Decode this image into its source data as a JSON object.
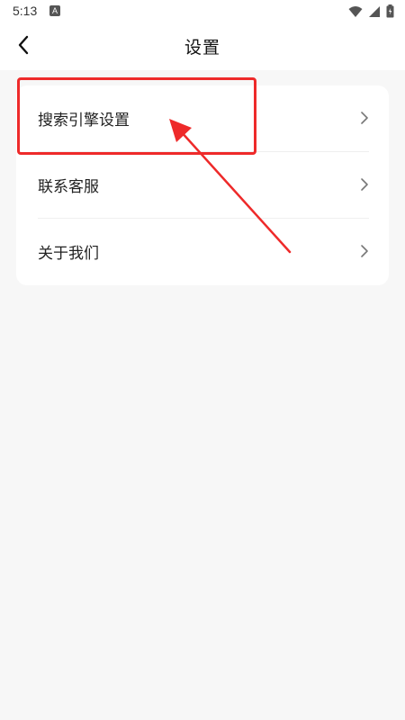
{
  "status_bar": {
    "time": "5:13",
    "notification_icon": "A"
  },
  "header": {
    "title": "设置",
    "back_icon": "chevron-left-icon"
  },
  "settings_list": {
    "items": [
      {
        "label": "搜索引擎设置",
        "icon": "chevron-right-icon"
      },
      {
        "label": "联系客服",
        "icon": "chevron-right-icon"
      },
      {
        "label": "关于我们",
        "icon": "chevron-right-icon"
      }
    ]
  },
  "annotation": {
    "color": "#ee2a2a",
    "highlighted_item": "搜索引擎设置"
  },
  "colors": {
    "background": "#f7f7f7",
    "card": "#ffffff",
    "text": "#222222",
    "chevron": "#777777"
  }
}
